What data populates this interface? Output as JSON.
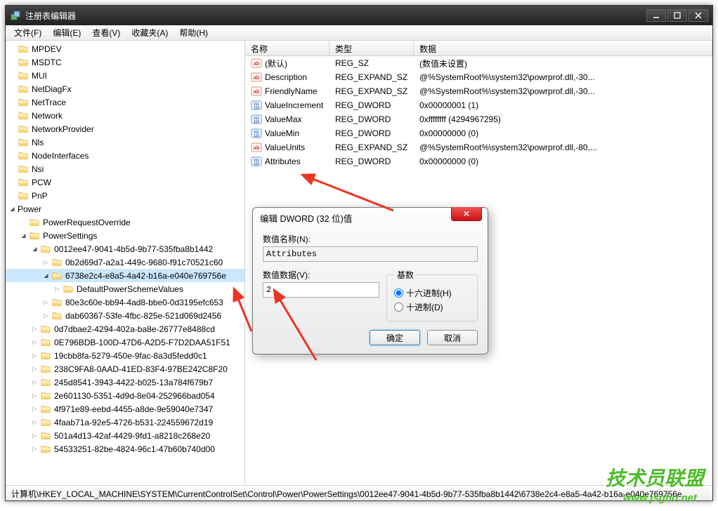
{
  "window": {
    "title": "注册表编辑器"
  },
  "menus": [
    "文件(F)",
    "编辑(E)",
    "查看(V)",
    "收藏夹(A)",
    "帮助(H)"
  ],
  "tree": [
    {
      "depth": 0,
      "expand": "none",
      "label": "MPDEV"
    },
    {
      "depth": 0,
      "expand": "none",
      "label": "MSDTC"
    },
    {
      "depth": 0,
      "expand": "none",
      "label": "MUI"
    },
    {
      "depth": 0,
      "expand": "none",
      "label": "NetDiagFx"
    },
    {
      "depth": 0,
      "expand": "none",
      "label": "NetTrace"
    },
    {
      "depth": 0,
      "expand": "none",
      "label": "Network"
    },
    {
      "depth": 0,
      "expand": "none",
      "label": "NetworkProvider"
    },
    {
      "depth": 0,
      "expand": "none",
      "label": "Nls"
    },
    {
      "depth": 0,
      "expand": "none",
      "label": "NodeInterfaces"
    },
    {
      "depth": 0,
      "expand": "none",
      "label": "Nsi"
    },
    {
      "depth": 0,
      "expand": "none",
      "label": "PCW"
    },
    {
      "depth": 0,
      "expand": "none",
      "label": "PnP"
    },
    {
      "depth": 0,
      "expand": "expanded",
      "label": "Power",
      "nofolder": true
    },
    {
      "depth": 1,
      "expand": "none",
      "label": "PowerRequestOverride"
    },
    {
      "depth": 1,
      "expand": "expanded",
      "label": "PowerSettings"
    },
    {
      "depth": 2,
      "expand": "expanded",
      "label": "0012ee47-9041-4b5d-9b77-535fba8b1442"
    },
    {
      "depth": 3,
      "expand": "collapsed",
      "label": "0b2d69d7-a2a1-449c-9680-f91c70521c60"
    },
    {
      "depth": 3,
      "expand": "expanded",
      "label": "6738e2c4-e8a5-4a42-b16a-e040e769756e",
      "selected": true
    },
    {
      "depth": 4,
      "expand": "collapsed",
      "label": "DefaultPowerSchemeValues"
    },
    {
      "depth": 3,
      "expand": "collapsed",
      "label": "80e3c60e-bb94-4ad8-bbe0-0d3195efc653"
    },
    {
      "depth": 3,
      "expand": "collapsed",
      "label": "dab60367-53fe-4fbc-825e-521d069d2456"
    },
    {
      "depth": 2,
      "expand": "collapsed",
      "label": "0d7dbae2-4294-402a-ba8e-26777e8488cd"
    },
    {
      "depth": 2,
      "expand": "collapsed",
      "label": "0E796BDB-100D-47D6-A2D5-F7D2DAA51F51"
    },
    {
      "depth": 2,
      "expand": "collapsed",
      "label": "19cbb8fa-5279-450e-9fac-8a3d5fedd0c1"
    },
    {
      "depth": 2,
      "expand": "collapsed",
      "label": "238C9FA8-0AAD-41ED-83F4-97BE242C8F20"
    },
    {
      "depth": 2,
      "expand": "collapsed",
      "label": "245d8541-3943-4422-b025-13a784f679b7"
    },
    {
      "depth": 2,
      "expand": "collapsed",
      "label": "2e601130-5351-4d9d-8e04-252966bad054"
    },
    {
      "depth": 2,
      "expand": "collapsed",
      "label": "4f971e89-eebd-4455-a8de-9e59040e7347"
    },
    {
      "depth": 2,
      "expand": "collapsed",
      "label": "4faab71a-92e5-4726-b531-224559672d19"
    },
    {
      "depth": 2,
      "expand": "collapsed",
      "label": "501a4d13-42af-4429-9fd1-a8218c268e20"
    },
    {
      "depth": 2,
      "expand": "collapsed",
      "label": "54533251-82be-4824-96c1-47b60b740d00"
    }
  ],
  "columns": {
    "name": "名称",
    "type": "类型",
    "data": "数据"
  },
  "rows": [
    {
      "icon": "ab",
      "name": "(默认)",
      "type": "REG_SZ",
      "data": "(数值未设置)"
    },
    {
      "icon": "ab",
      "name": "Description",
      "type": "REG_EXPAND_SZ",
      "data": "@%SystemRoot%\\system32\\powrprof.dll,-30..."
    },
    {
      "icon": "ab",
      "name": "FriendlyName",
      "type": "REG_EXPAND_SZ",
      "data": "@%SystemRoot%\\system32\\powrprof.dll,-30..."
    },
    {
      "icon": "bin",
      "name": "ValueIncrement",
      "type": "REG_DWORD",
      "data": "0x00000001 (1)"
    },
    {
      "icon": "bin",
      "name": "ValueMax",
      "type": "REG_DWORD",
      "data": "0xffffffff (4294967295)"
    },
    {
      "icon": "bin",
      "name": "ValueMin",
      "type": "REG_DWORD",
      "data": "0x00000000 (0)"
    },
    {
      "icon": "ab",
      "name": "ValueUnits",
      "type": "REG_EXPAND_SZ",
      "data": "@%SystemRoot%\\system32\\powrprof.dll,-80,..."
    },
    {
      "icon": "bin",
      "name": "Attributes",
      "type": "REG_DWORD",
      "data": "0x00000000 (0)"
    }
  ],
  "statusbar": "计算机\\HKEY_LOCAL_MACHINE\\SYSTEM\\CurrentControlSet\\Control\\Power\\PowerSettings\\0012ee47-9041-4b5d-9b77-535fba8b1442\\6738e2c4-e8a5-4a42-b16a-e040e769756e",
  "dialog": {
    "title": "编辑 DWORD (32 位)值",
    "name_label": "数值名称(N):",
    "name_value": "Attributes",
    "data_label": "数值数据(V):",
    "data_value": "2",
    "base_label": "基数",
    "radio_hex": "十六进制(H)",
    "radio_dec": "十进制(D)",
    "ok": "确定",
    "cancel": "取消"
  },
  "watermark": {
    "text": "技术员联盟",
    "url": "www.jsgho.net"
  }
}
